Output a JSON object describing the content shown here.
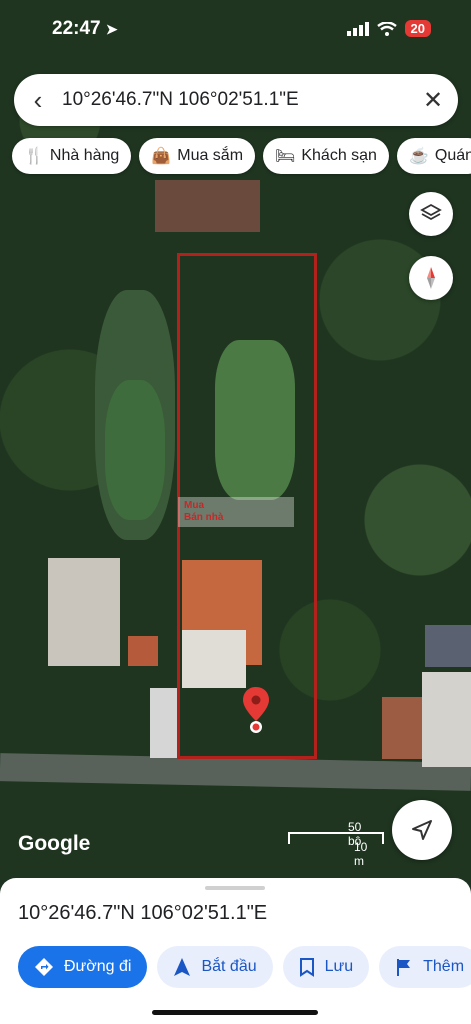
{
  "status_bar": {
    "time": "22:47",
    "battery": "20"
  },
  "search": {
    "query": "10°26'46.7\"N 106°02'51.1\"E"
  },
  "chips": [
    {
      "icon": "fork-knife-icon",
      "label": "Nhà hàng"
    },
    {
      "icon": "shopping-bag-icon",
      "label": "Mua sắm"
    },
    {
      "icon": "bed-icon",
      "label": "Khách sạn"
    },
    {
      "icon": "coffee-cup-icon",
      "label": "Quán"
    }
  ],
  "watermark": {
    "line1": "Mua",
    "line2": "Bán nhà"
  },
  "map": {
    "brand": "Google",
    "scale_top": "50 bộ",
    "scale_bottom": "10 m"
  },
  "colors": {
    "accent": "#1a73e8",
    "plot_outline": "#b3211d",
    "pin": "#e53935"
  },
  "sheet": {
    "coords": "10°26'46.7\"N 106°02'51.1\"E",
    "actions": [
      {
        "icon": "directions-icon",
        "label": "Đường đi"
      },
      {
        "icon": "navigation-arrow-icon",
        "label": "Bắt đầu"
      },
      {
        "icon": "bookmark-icon",
        "label": "Lưu"
      },
      {
        "icon": "flag-icon",
        "label": "Thêm"
      }
    ]
  }
}
